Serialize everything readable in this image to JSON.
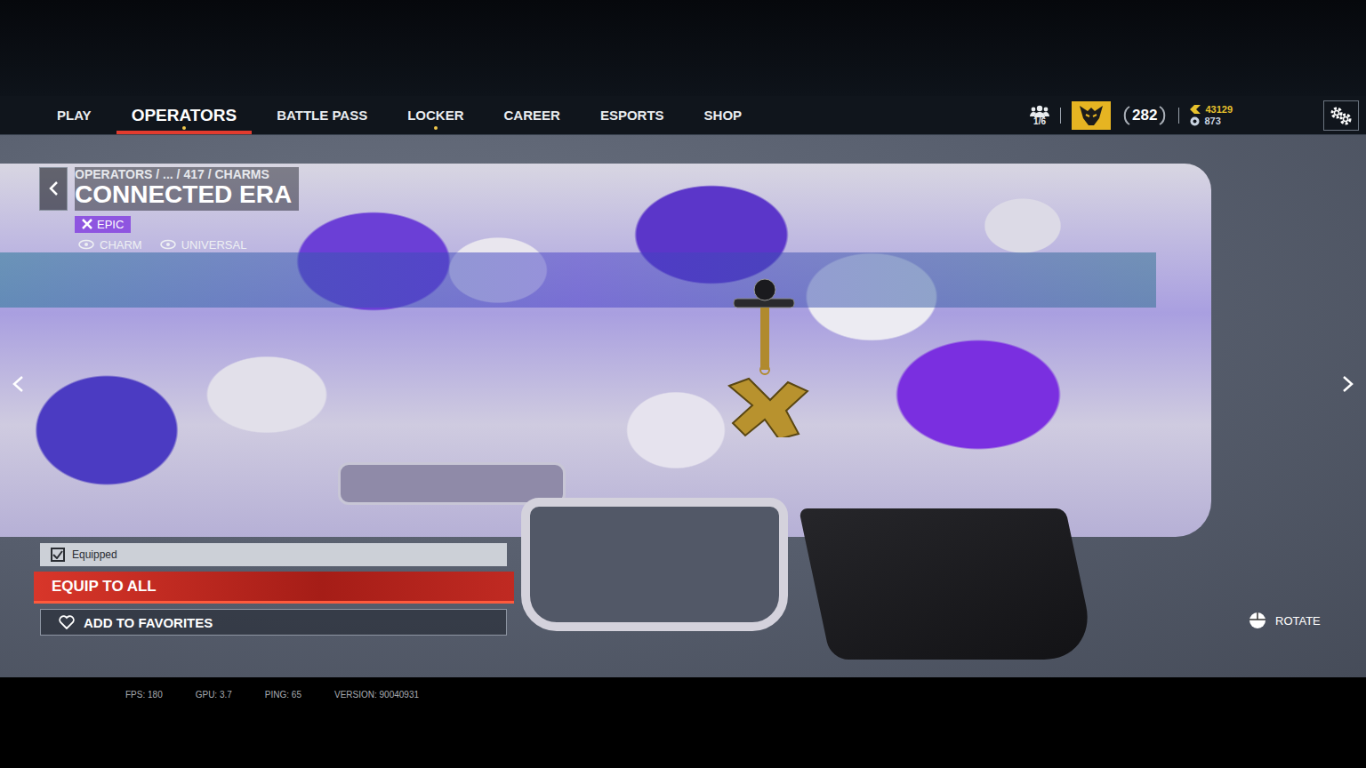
{
  "nav": {
    "tabs": [
      {
        "label": "PLAY",
        "selected": false,
        "notify": false
      },
      {
        "label": "OPERATORS",
        "selected": true,
        "notify": true
      },
      {
        "label": "BATTLE PASS",
        "selected": false,
        "notify": false
      },
      {
        "label": "LOCKER",
        "selected": false,
        "notify": true
      },
      {
        "label": "CAREER",
        "selected": false,
        "notify": false
      },
      {
        "label": "ESPORTS",
        "selected": false,
        "notify": false
      },
      {
        "label": "SHOP",
        "selected": false,
        "notify": false
      }
    ]
  },
  "status": {
    "squad": "1/6",
    "level": "282",
    "credits": "43129",
    "renown": "873"
  },
  "item": {
    "breadcrumb": "OPERATORS / ... / 417 / CHARMS",
    "title": "CONNECTED ERA",
    "rarity": "EPIC",
    "tags": [
      "CHARM",
      "UNIVERSAL"
    ]
  },
  "actions": {
    "equipped": {
      "label": "Equipped",
      "checked": true
    },
    "equip_all": "EQUIP TO ALL",
    "favorite": "ADD TO FAVORITES"
  },
  "rotate": "ROTATE",
  "stats": [
    "FPS: 180",
    "GPU: 3.7",
    "PING: 65",
    "VERSION: 90040931"
  ]
}
